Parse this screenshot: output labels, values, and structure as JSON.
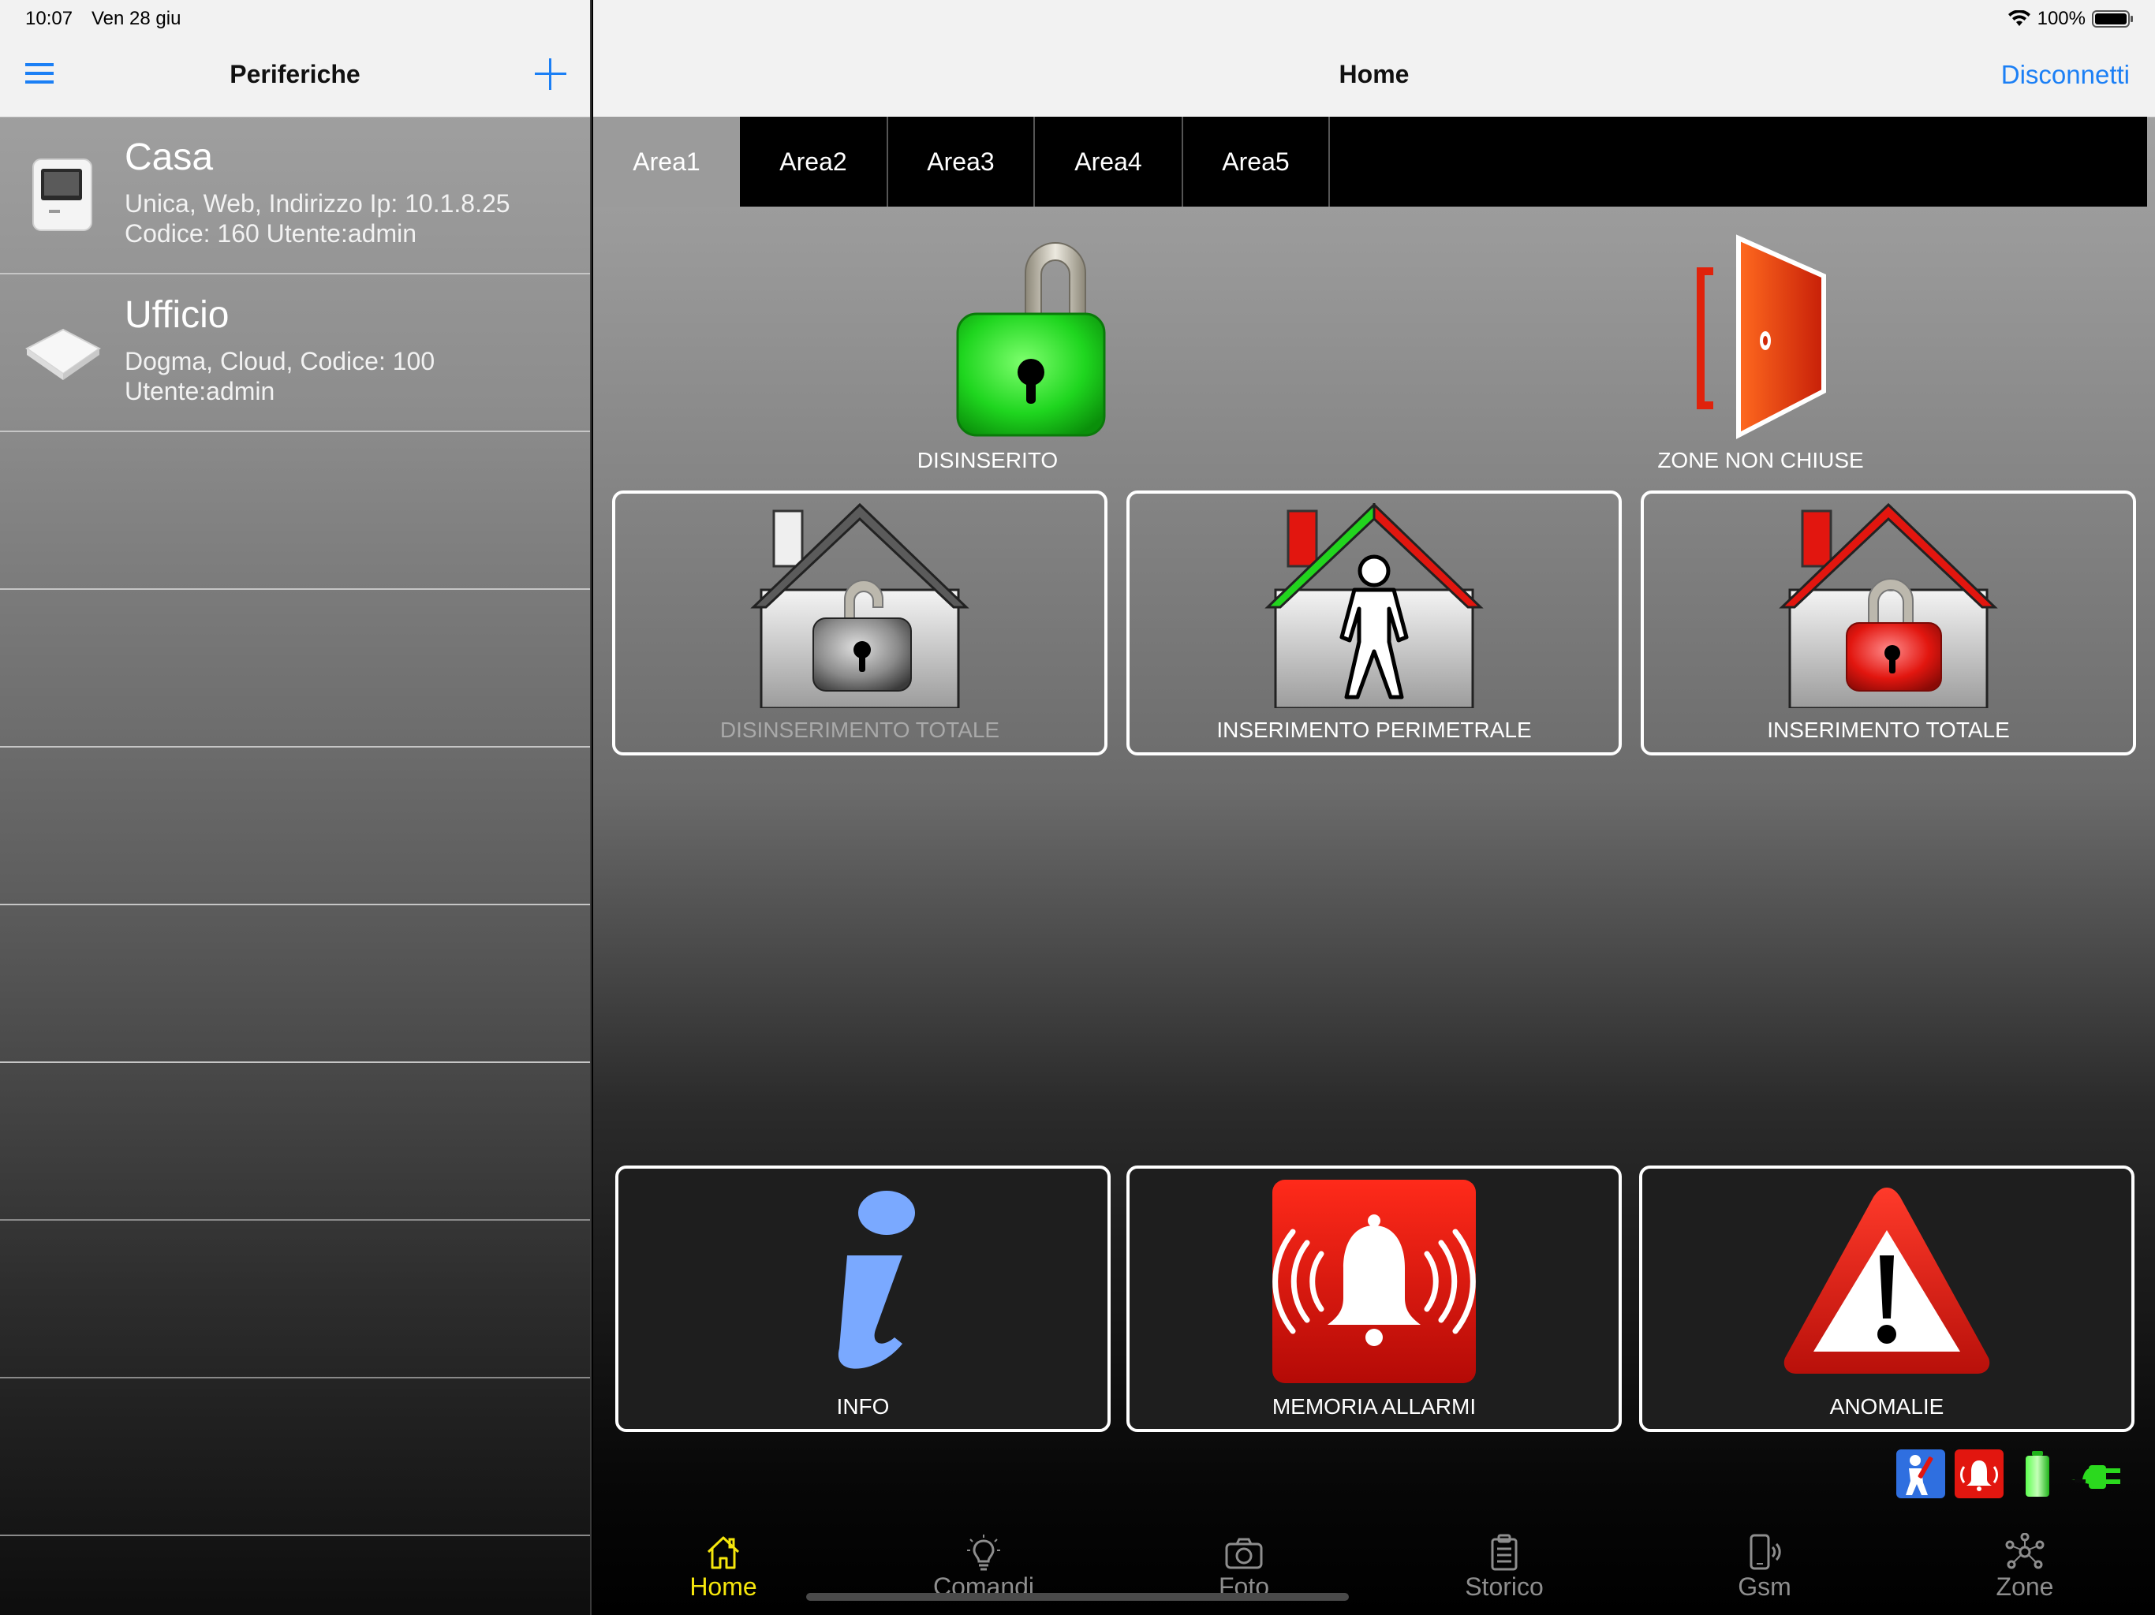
{
  "status_bar": {
    "time": "10:07",
    "date": "Ven 28 giu",
    "battery": "100%"
  },
  "master": {
    "title": "Periferiche",
    "devices": [
      {
        "name": "Casa",
        "line1": "Unica, Web, Indirizzo Ip: 10.1.8.25",
        "line2": "Codice: 160 Utente:admin"
      },
      {
        "name": "Ufficio",
        "line1": "Dogma, Cloud, Codice: 100",
        "line2": "Utente:admin"
      }
    ]
  },
  "detail": {
    "title": "Home",
    "disconnect_label": "Disconnetti",
    "tabs": [
      "Area1",
      "Area2",
      "Area3",
      "Area4",
      "Area5"
    ],
    "active_tab": "Area1",
    "status": {
      "arm_state": "DISINSERITO",
      "zones_state": "ZONE NON CHIUSE"
    },
    "commands": {
      "disarm_total": "DISINSERIMENTO TOTALE",
      "arm_perimeter": "INSERIMENTO PERIMETRALE",
      "arm_total": "INSERIMENTO TOTALE"
    },
    "actions": {
      "info": "INFO",
      "alarm_memory": "MEMORIA ALLARMI",
      "anomalies": "ANOMALIE"
    }
  },
  "tabbar": {
    "items": [
      "Home",
      "Comandi",
      "Foto",
      "Storico",
      "Gsm",
      "Zone"
    ],
    "active": "Home"
  },
  "colors": {
    "accent": "#1b7ff5",
    "active_tab_label": "#f5e60c",
    "lock_green": "#1fd61f",
    "alarm_red": "#e6140e"
  }
}
